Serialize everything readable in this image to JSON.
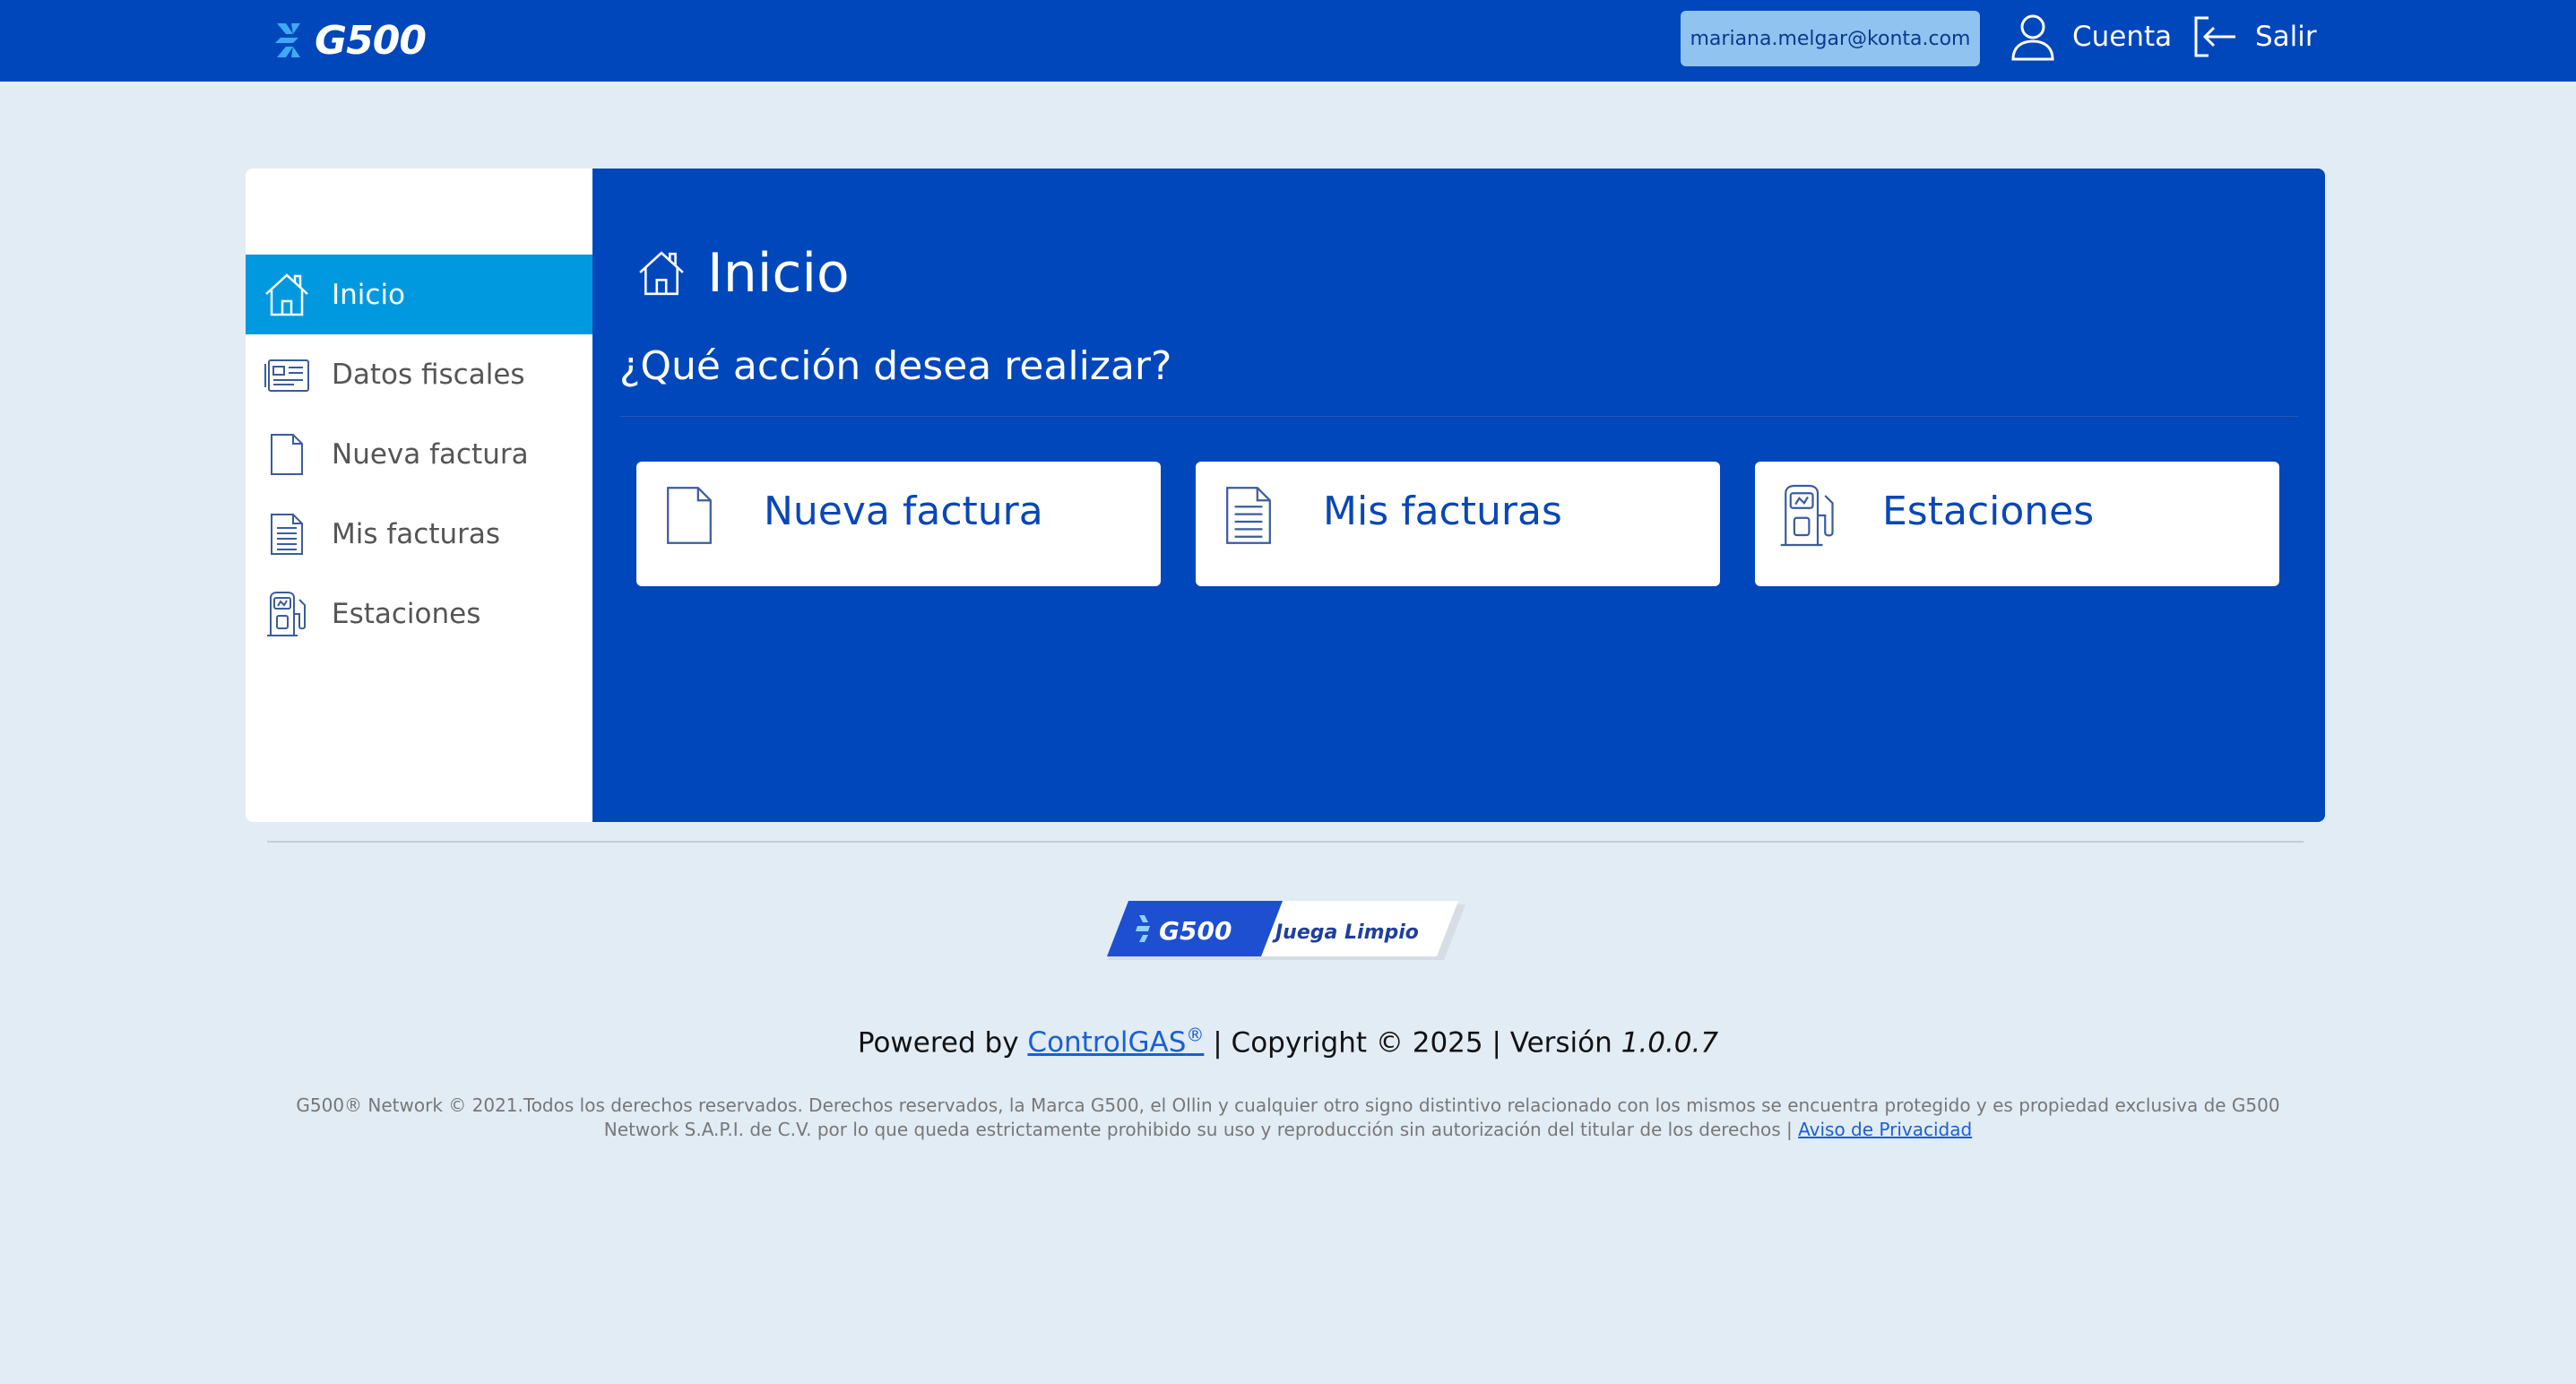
{
  "header": {
    "brand": "G500",
    "user_email": "mariana.melgar@konta.com",
    "account_label": "Cuenta",
    "logout_label": "Salir"
  },
  "sidebar": {
    "items": [
      {
        "label": "Inicio",
        "icon": "home-icon",
        "active": true
      },
      {
        "label": "Datos fiscales",
        "icon": "fiscal-card-icon",
        "active": false
      },
      {
        "label": "Nueva factura",
        "icon": "blank-document-icon",
        "active": false
      },
      {
        "label": "Mis facturas",
        "icon": "lined-document-icon",
        "active": false
      },
      {
        "label": "Estaciones",
        "icon": "gas-pump-icon",
        "active": false
      }
    ]
  },
  "main": {
    "title": "Inicio",
    "question": "¿Qué acción desea realizar?",
    "cards": [
      {
        "label": "Nueva factura",
        "icon": "blank-document-icon"
      },
      {
        "label": "Mis facturas",
        "icon": "lined-document-icon"
      },
      {
        "label": "Estaciones",
        "icon": "gas-pump-icon"
      }
    ]
  },
  "footer": {
    "badge_brand": "G500",
    "badge_slogan": "Juega Limpio",
    "powered_prefix": "Powered by",
    "powered_link": "ControlGAS",
    "powered_reg": "®",
    "copyright": "| Copyright © 2025 | Versión",
    "version": "1.0.0.7",
    "legal_text": "G500® Network © 2021.Todos los derechos reservados. Derechos reservados, la Marca G500, el Ollin y cualquier otro signo distintivo relacionado con los mismos se encuentra protegido y es propiedad exclusiva de G500 Network S.A.P.I. de C.V. por lo que queda estrictamente prohibido su uso y reproducción sin autorización del titular de los derechos |",
    "privacy_link": "Aviso de Privacidad"
  },
  "colors": {
    "brand_blue": "#0047bb",
    "active_blue": "#0099e0",
    "background": "#e2ecf5",
    "email_badge": "#91c3f0"
  }
}
